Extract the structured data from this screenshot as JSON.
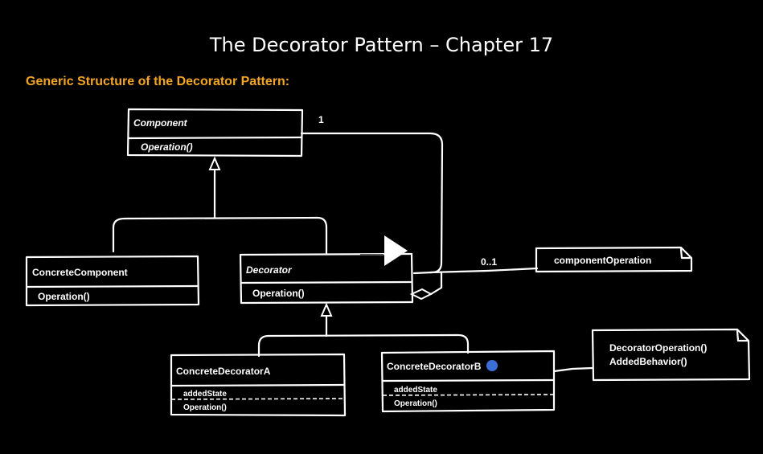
{
  "title": "The Decorator Pattern – Chapter 17",
  "subtitle": "Generic Structure of the Decorator Pattern:",
  "colors": {
    "accent": "#f5a623",
    "marker": "#3a6fd8"
  },
  "component": {
    "name": "Component",
    "operation": "Operation()"
  },
  "concrete_component": {
    "name": "ConcreteComponent",
    "operation": "Operation()"
  },
  "decorator": {
    "name": "Decorator",
    "operation": "Operation()"
  },
  "concrete_decorator_a": {
    "name": "ConcreteDecoratorA",
    "attribute": "addedState",
    "operation": "Operation()"
  },
  "concrete_decorator_b": {
    "name": "ConcreteDecoratorB",
    "attribute": "addedState",
    "operation": "Operation()"
  },
  "multiplicity_one": "1",
  "multiplicity_zero_one": "0..1",
  "note_component": "componentOperation",
  "note_decorator": {
    "line1": "DecoratorOperation()",
    "line2": "AddedBehavior()"
  }
}
